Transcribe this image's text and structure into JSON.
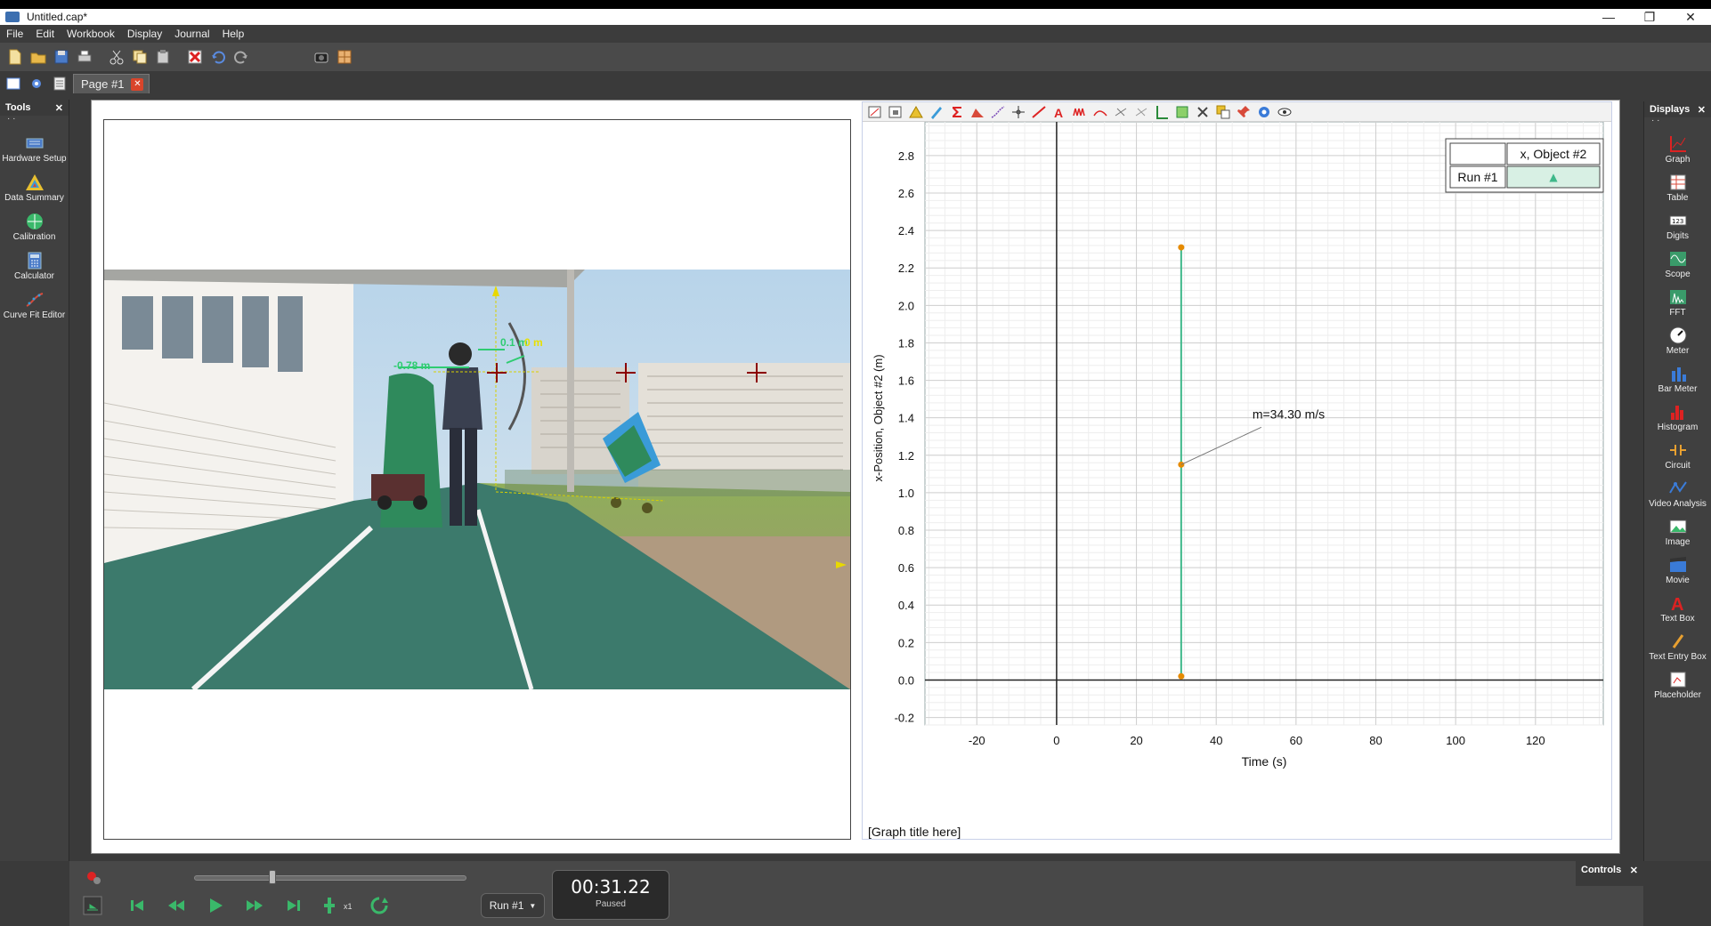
{
  "window": {
    "title": "Untitled.cap*",
    "buttons": [
      "—",
      "❐",
      "✕"
    ]
  },
  "menu": [
    "File",
    "Edit",
    "Workbook",
    "Display",
    "Journal",
    "Help"
  ],
  "page_tabs": [
    {
      "label": "Page #1"
    }
  ],
  "tools": {
    "header": "Tools",
    "close": "✕",
    "dots": "· ·",
    "items": [
      {
        "label": "Hardware Setup",
        "icon": "hardware-setup-icon"
      },
      {
        "label": "Data Summary",
        "icon": "data-summary-icon"
      },
      {
        "label": "Calibration",
        "icon": "calibration-icon"
      },
      {
        "label": "Calculator",
        "icon": "calculator-icon"
      },
      {
        "label": "Curve Fit Editor",
        "icon": "curve-fit-editor-icon"
      }
    ]
  },
  "displays": {
    "header": "Displays",
    "close": "✕",
    "dots": "· ·",
    "items": [
      {
        "label": "Graph",
        "icon": "graph-icon"
      },
      {
        "label": "Table",
        "icon": "table-icon"
      },
      {
        "label": "Digits",
        "icon": "digits-icon"
      },
      {
        "label": "Scope",
        "icon": "scope-icon"
      },
      {
        "label": "FFT",
        "icon": "fft-icon"
      },
      {
        "label": "Meter",
        "icon": "meter-icon"
      },
      {
        "label": "Bar Meter",
        "icon": "bar-meter-icon"
      },
      {
        "label": "Histogram",
        "icon": "histogram-icon"
      },
      {
        "label": "Circuit",
        "icon": "circuit-icon"
      },
      {
        "label": "Video Analysis",
        "icon": "video-analysis-icon"
      },
      {
        "label": "Image",
        "icon": "image-icon"
      },
      {
        "label": "Movie",
        "icon": "movie-icon"
      },
      {
        "label": "Text Box",
        "icon": "text-box-icon"
      },
      {
        "label": "Text Entry Box",
        "icon": "text-entry-box-icon"
      },
      {
        "label": "Placeholder",
        "icon": "placeholder-icon"
      }
    ]
  },
  "video": {
    "labels": {
      "left_distance": "-0.78 m",
      "right_distance": "0.1 m",
      "overlap_text": "0 m"
    }
  },
  "graph": {
    "title_placeholder": "[Graph title here]",
    "legend": {
      "column_header": "x, Object #2",
      "row_label": "Run #1",
      "marker": "▲"
    },
    "annotation": "m=34.30 m/s",
    "chart_data": {
      "type": "line",
      "xlabel": "Time (s)",
      "ylabel": "x-Position, Object #2 (m)",
      "xlim": [
        -33,
        137
      ],
      "ylim": [
        -0.24,
        2.98
      ],
      "x_ticks": [
        -20,
        0,
        20,
        40,
        60,
        80,
        100,
        120
      ],
      "y_ticks": [
        -0.2,
        0.0,
        0.2,
        0.4,
        0.6,
        0.8,
        1.0,
        1.2,
        1.4,
        1.6,
        1.8,
        2.0,
        2.2,
        2.4,
        2.6,
        2.8
      ],
      "grid": true,
      "series": [
        {
          "name": "x, Object #2",
          "color": "#3fb88a",
          "point_color": "#e58a00",
          "x": [
            31.22,
            31.22,
            31.22
          ],
          "values": [
            0.02,
            1.15,
            2.31
          ]
        }
      ]
    }
  },
  "controls": {
    "header": "Controls",
    "close": "✕",
    "dots": "· ·",
    "run_select": "Run #1",
    "time": "00:31.22",
    "status": "Paused",
    "speed": "x1"
  }
}
